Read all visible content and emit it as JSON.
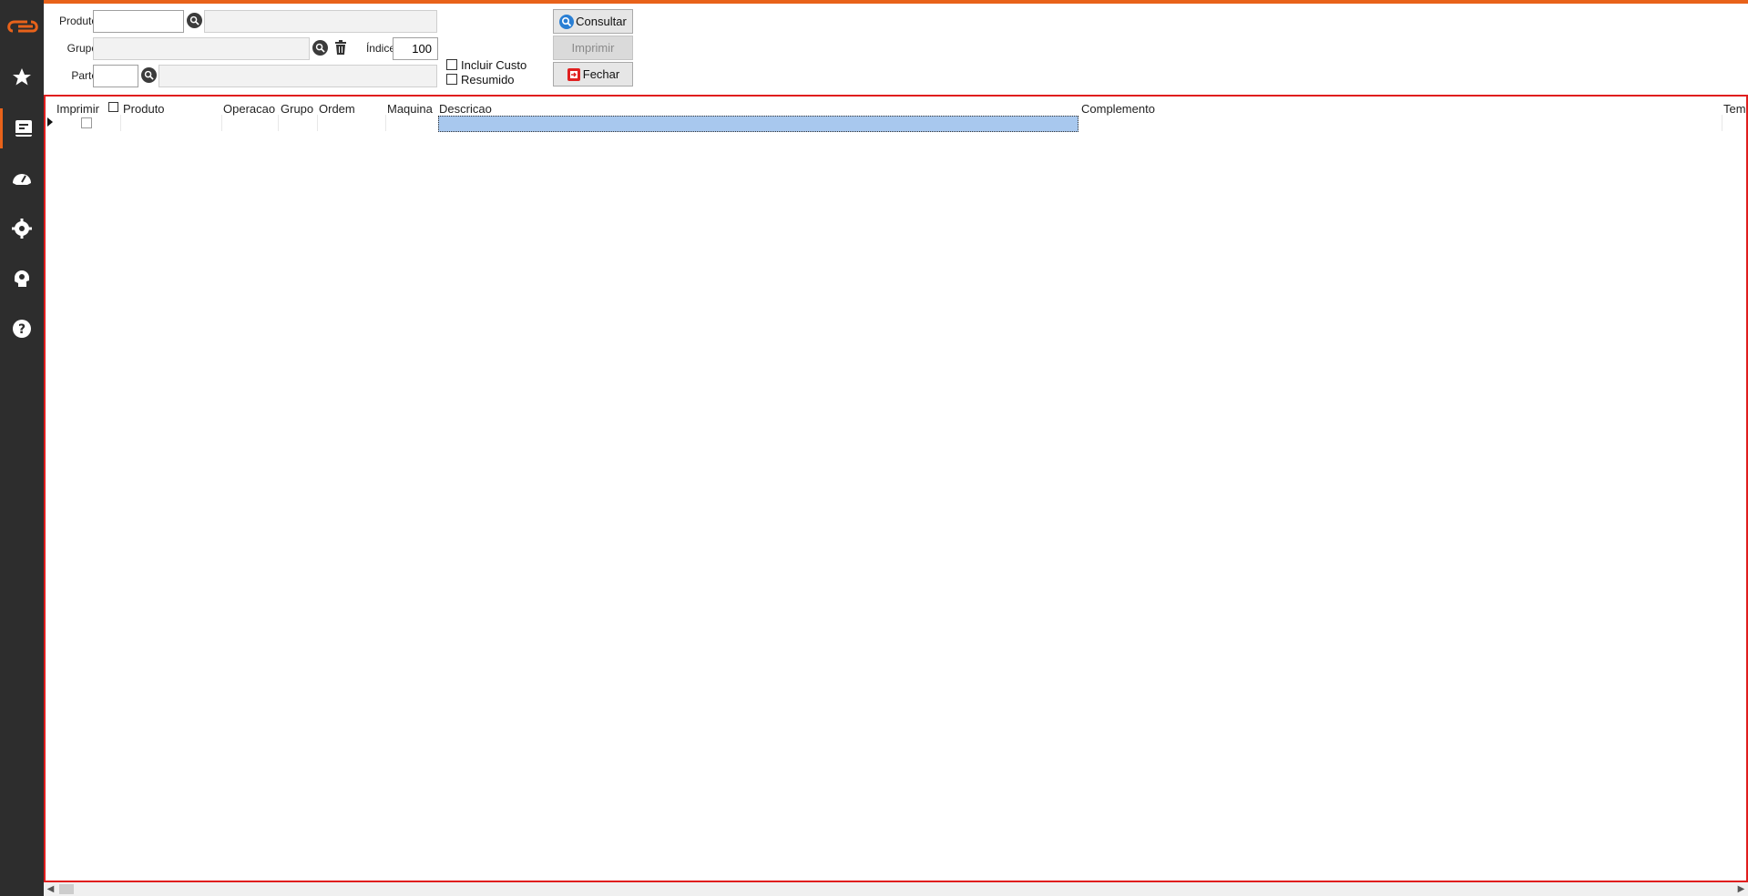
{
  "filters": {
    "produto_label": "Produto",
    "produto_code": "",
    "produto_desc": "",
    "grupo_label": "Grupo",
    "grupo_value": "",
    "indice_label": "Índice",
    "indice_value": "100",
    "parte_label": "Parte",
    "parte_code": "",
    "parte_desc": "",
    "incluir_custo_label": "Incluir Custo",
    "incluir_custo_checked": false,
    "resumido_label": "Resumido",
    "resumido_checked": false
  },
  "buttons": {
    "consultar": "Consultar",
    "imprimir": "Imprimir",
    "fechar": "Fechar"
  },
  "grid": {
    "columns": {
      "imprimir": "Imprimir",
      "produto": "Produto",
      "operacao": "Operacao",
      "grupo": "Grupo",
      "ordem": "Ordem",
      "maquina": "Maquina",
      "descricao": "Descricao",
      "complemento": "Complemento",
      "tempo": "Tem"
    },
    "rows": [
      {
        "imprimir": false,
        "produto": "",
        "operacao": "",
        "grupo": "",
        "ordem": "",
        "maquina": "",
        "descricao": "",
        "complemento": ""
      }
    ]
  },
  "colors": {
    "accent": "#e8621a",
    "sidebar": "#2d2d2d",
    "grid_border": "#e01e1e",
    "selection": "#a8c8ee"
  },
  "sidebar_icons": [
    "logo",
    "star-icon",
    "report-icon",
    "dashboard-icon",
    "gear-icon",
    "head-gear-icon",
    "help-icon"
  ]
}
